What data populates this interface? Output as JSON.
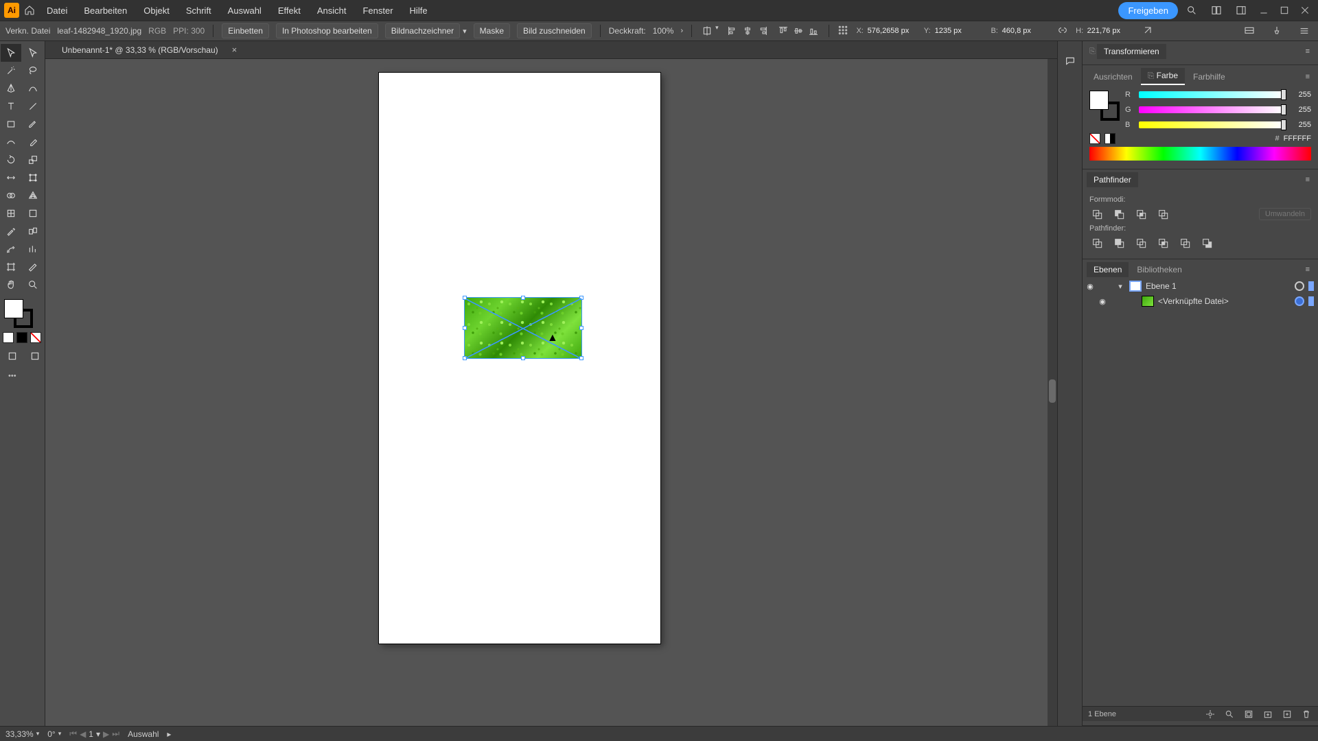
{
  "menubar": {
    "app_initials": "Ai",
    "items": [
      "Datei",
      "Bearbeiten",
      "Objekt",
      "Schrift",
      "Auswahl",
      "Effekt",
      "Ansicht",
      "Fenster",
      "Hilfe"
    ],
    "share": "Freigeben"
  },
  "optionsbar": {
    "kind": "Verkn. Datei",
    "filename": "leaf-1482948_1920.jpg",
    "colormode": "RGB",
    "ppi_label": "PPI:",
    "ppi": "300",
    "embed": "Einbetten",
    "edit_ps": "In Photoshop bearbeiten",
    "image_trace": "Bildnachzeichner",
    "mask": "Maske",
    "crop": "Bild zuschneiden",
    "opacity_label": "Deckkraft:",
    "opacity": "100%",
    "x_label": "X:",
    "x_value": "576,2658 px",
    "y_label": "Y:",
    "y_value": "1235 px",
    "w_label": "B:",
    "w_value": "460,8 px",
    "h_label": "H:",
    "h_value": "221,76 px"
  },
  "doc_tab": {
    "title": "Unbenannt-1* @ 33,33 % (RGB/Vorschau)"
  },
  "color": {
    "tabs": {
      "transform": "Transformieren",
      "align": "Ausrichten",
      "color": "Farbe",
      "guide": "Farbhilfe"
    },
    "r_label": "R",
    "r_value": "255",
    "g_label": "G",
    "g_value": "255",
    "b_label": "B",
    "b_value": "255",
    "hash": "#",
    "hex": "FFFFFF"
  },
  "pathfinder": {
    "tab": "Pathfinder",
    "shapemodes": "Formmodi:",
    "expand": "Umwandeln",
    "label2": "Pathfinder:"
  },
  "layers": {
    "tab_layers": "Ebenen",
    "tab_libs": "Bibliotheken",
    "row1": "Ebene 1",
    "row2": "<Verknüpfte Datei>",
    "footer_count": "1 Ebene"
  },
  "status": {
    "zoom": "33,33%",
    "rotate": "0°",
    "artboard": "1",
    "tool": "Auswahl"
  }
}
